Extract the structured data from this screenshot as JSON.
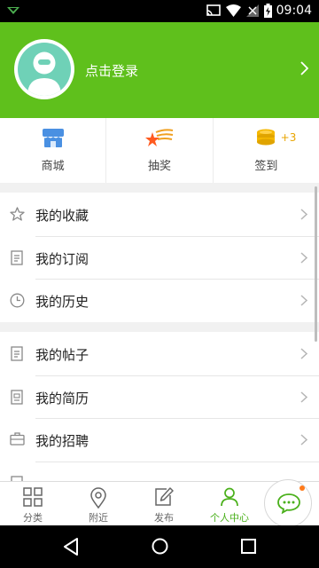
{
  "status_bar": {
    "time": "09:04"
  },
  "header": {
    "login_text": "点击登录"
  },
  "quick_actions": [
    {
      "label": "商城",
      "icon": "shop-icon"
    },
    {
      "label": "抽奖",
      "icon": "lottery-star-icon"
    },
    {
      "label": "签到",
      "icon": "coins-icon",
      "badge": "+3"
    }
  ],
  "menu_groups": [
    [
      {
        "label": "我的收藏",
        "icon": "star-icon"
      },
      {
        "label": "我的订阅",
        "icon": "document-icon"
      },
      {
        "label": "我的历史",
        "icon": "clock-icon"
      }
    ],
    [
      {
        "label": "我的帖子",
        "icon": "document-icon"
      },
      {
        "label": "我的简历",
        "icon": "resume-icon"
      },
      {
        "label": "我的招聘",
        "icon": "briefcase-icon"
      }
    ]
  ],
  "bottom_nav": [
    {
      "label": "分类",
      "icon": "grid-icon",
      "active": false
    },
    {
      "label": "附近",
      "icon": "location-pin-icon",
      "active": false
    },
    {
      "label": "发布",
      "icon": "edit-icon",
      "active": false
    },
    {
      "label": "个人中心",
      "icon": "person-icon",
      "active": true
    }
  ],
  "colors": {
    "brand_green": "#5fc01c",
    "active_nav": "#4ab01b",
    "badge_orange": "#e8a400"
  }
}
